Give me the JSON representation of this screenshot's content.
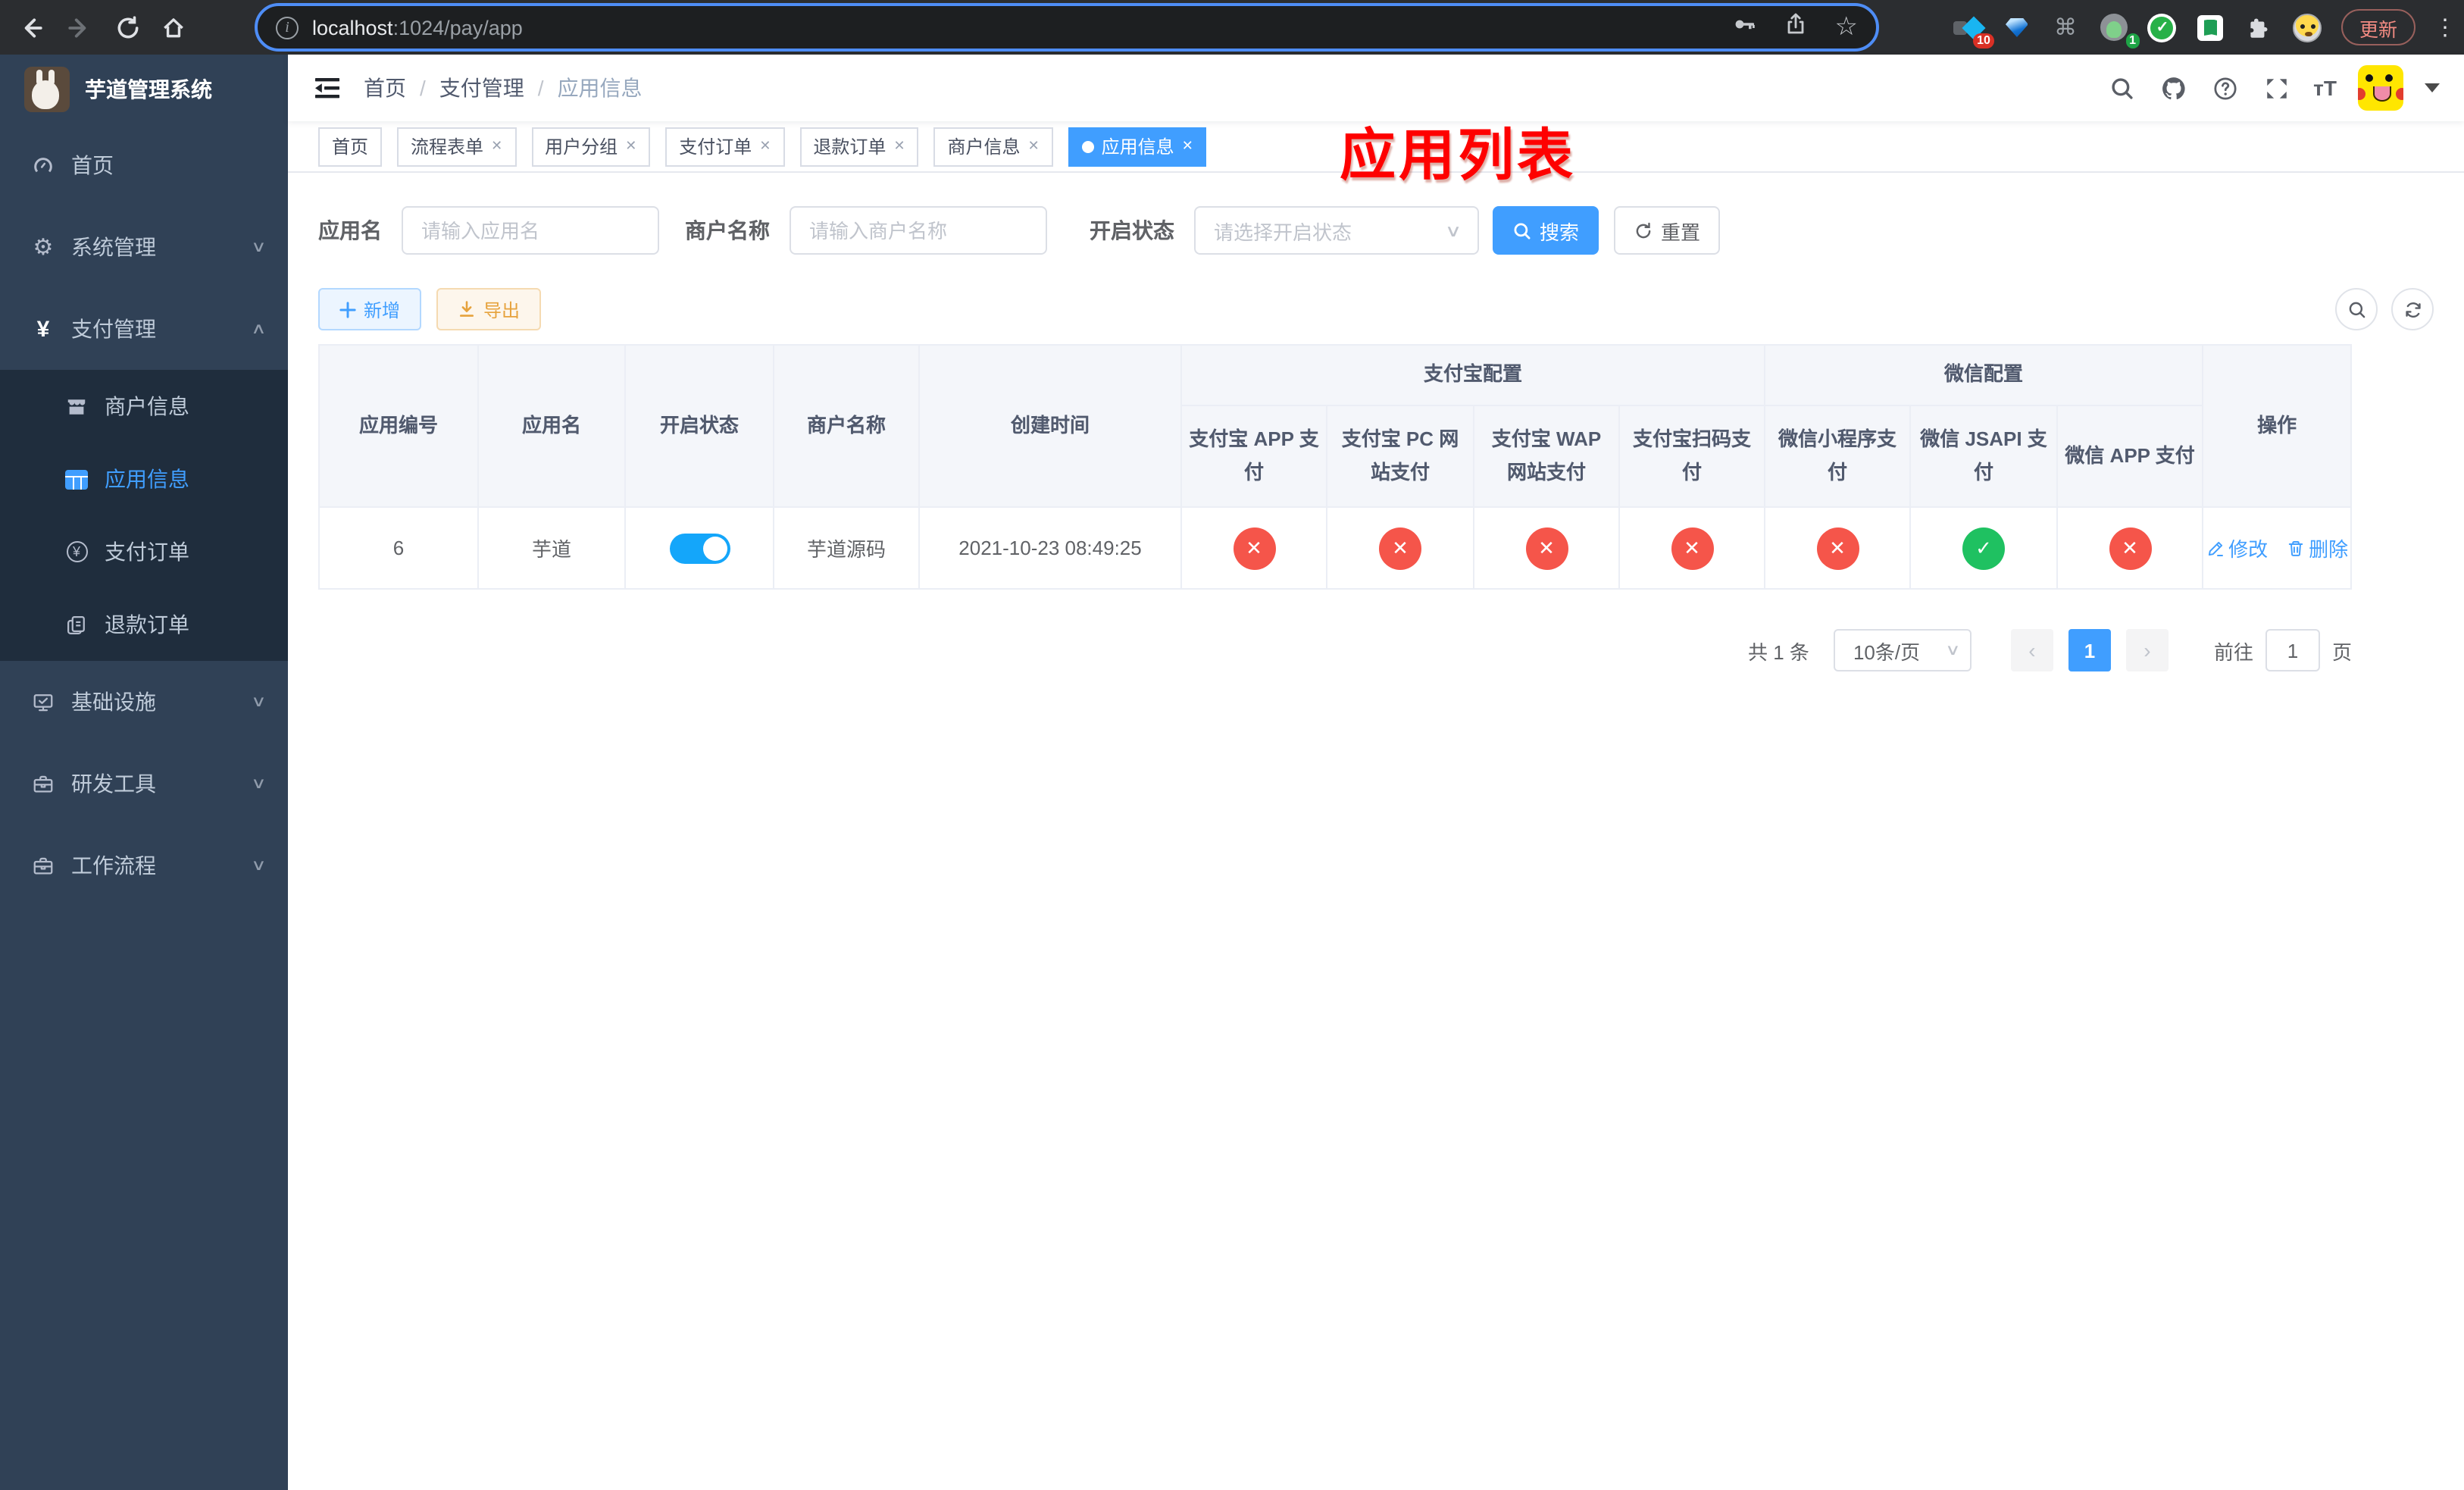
{
  "browser": {
    "url_host": "localhost",
    "url_path": ":1024/pay/app",
    "update_label": "更新",
    "ext_badge_ten": "10",
    "ext_badge_one": "1"
  },
  "sidebar": {
    "title": "芋道管理系统",
    "menu": [
      {
        "label": "首页"
      },
      {
        "label": "系统管理"
      },
      {
        "label": "支付管理"
      },
      {
        "label": "商户信息"
      },
      {
        "label": "应用信息"
      },
      {
        "label": "支付订单"
      },
      {
        "label": "退款订单"
      },
      {
        "label": "基础设施"
      },
      {
        "label": "研发工具"
      },
      {
        "label": "工作流程"
      }
    ]
  },
  "breadcrumb": {
    "items": [
      "首页",
      "支付管理",
      "应用信息"
    ],
    "separator": "/"
  },
  "annotation": "应用列表",
  "tabs": [
    {
      "label": "首页"
    },
    {
      "label": "流程表单"
    },
    {
      "label": "用户分组"
    },
    {
      "label": "支付订单"
    },
    {
      "label": "退款订单"
    },
    {
      "label": "商户信息"
    },
    {
      "label": "应用信息"
    }
  ],
  "filters": {
    "app_name_label": "应用名",
    "app_name_placeholder": "请输入应用名",
    "merchant_label": "商户名称",
    "merchant_placeholder": "请输入商户名称",
    "status_label": "开启状态",
    "status_placeholder": "请选择开启状态",
    "search_label": "搜索",
    "reset_label": "重置"
  },
  "toolbar": {
    "add_label": "新增",
    "export_label": "导出"
  },
  "table": {
    "headers": {
      "app_id": "应用编号",
      "app_name": "应用名",
      "status": "开启状态",
      "merchant": "商户名称",
      "created": "创建时间",
      "alipay_group": "支付宝配置",
      "wechat_group": "微信配置",
      "ops": "操作",
      "pay_methods": [
        "支付宝 APP 支付",
        "支付宝 PC 网站支付",
        "支付宝 WAP 网站支付",
        "支付宝扫码支付",
        "微信小程序支付",
        "微信 JSAPI 支付",
        "微信 APP 支付"
      ]
    },
    "row": {
      "app_id": "6",
      "app_name": "芋道",
      "enabled": true,
      "merchant": "芋道源码",
      "created": "2021-10-23 08:49:25",
      "pay_status": [
        "off",
        "off",
        "off",
        "off",
        "off",
        "on",
        "off"
      ],
      "edit_label": "修改",
      "delete_label": "删除"
    }
  },
  "pagination": {
    "total": "共 1 条",
    "page_size": "10条/页",
    "current_page": "1",
    "goto_label": "前往",
    "goto_value": "1",
    "page_unit": "页"
  },
  "colors": {
    "accent": "#409eff",
    "danger": "#f5554a",
    "success": "#1fc161",
    "sidebar_bg": "#304156",
    "submenu_bg": "#1f2d3d"
  }
}
